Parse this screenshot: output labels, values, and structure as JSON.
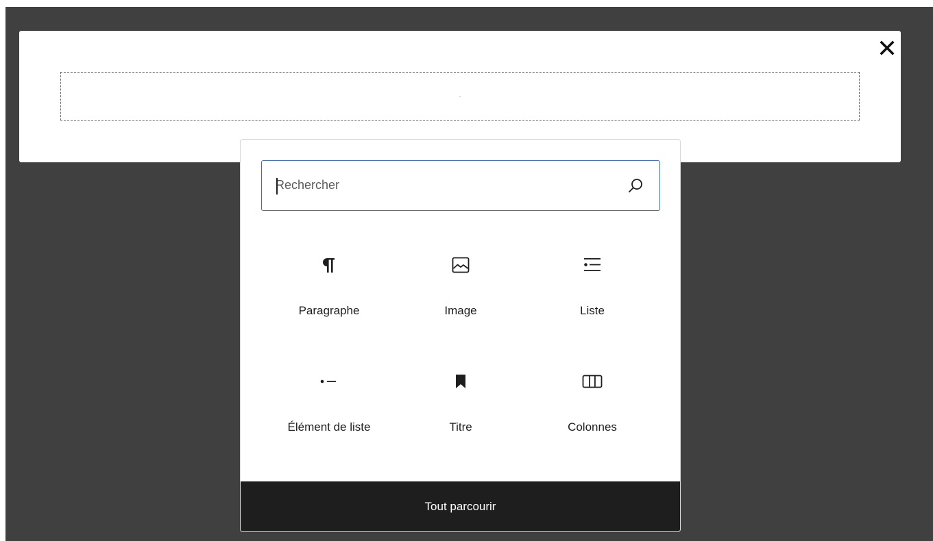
{
  "modal": {
    "close_icon": "close-icon"
  },
  "inserter": {
    "search": {
      "placeholder": "Rechercher",
      "value": "",
      "icon": "search-icon"
    },
    "blocks": [
      {
        "label": "Paragraphe",
        "icon": "paragraph-icon"
      },
      {
        "label": "Image",
        "icon": "image-icon"
      },
      {
        "label": "Liste",
        "icon": "list-icon"
      },
      {
        "label": "Élément de liste",
        "icon": "list-item-icon"
      },
      {
        "label": "Titre",
        "icon": "heading-icon"
      },
      {
        "label": "Colonnes",
        "icon": "columns-icon"
      }
    ],
    "browse_all_label": "Tout parcourir"
  },
  "colors": {
    "backdrop": "#404040",
    "focus_border": "#3e6db7",
    "footer_bg": "#1e1e1e"
  }
}
